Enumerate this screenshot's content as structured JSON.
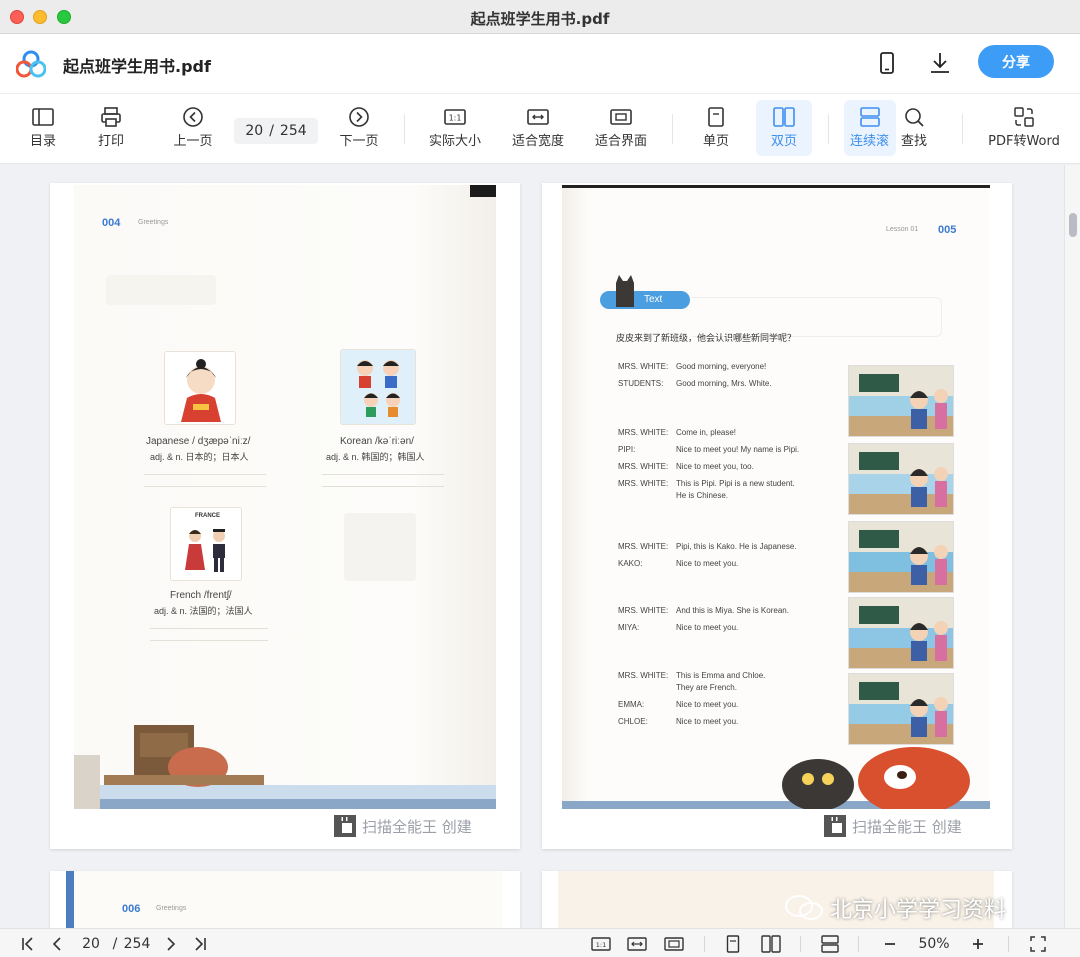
{
  "window": {
    "title": "起点班学生用书.pdf"
  },
  "header": {
    "file_name": "起点班学生用书.pdf",
    "share_label": "分享"
  },
  "toolbar": {
    "toc": "目录",
    "print": "打印",
    "prev": "上一页",
    "current_page": "20",
    "separator": "/",
    "total_pages": "254",
    "next": "下一页",
    "actual_size": "实际大小",
    "fit_width": "适合宽度",
    "fit_window": "适合界面",
    "single": "单页",
    "double": "双页",
    "continuous": "连续滚",
    "find": "查找",
    "pdf_to_word": "PDF转Word"
  },
  "pages": {
    "left": {
      "page_no": "004",
      "section": "Greetings",
      "words": [
        {
          "word": "Japanese / dʒæpəˈniːz/",
          "def": "adj. & n. 日本的；日本人"
        },
        {
          "word": "Korean /kəˈriːən/",
          "def": "adj. & n. 韩国的；韩国人"
        },
        {
          "word": "French /frentʃ/",
          "def": "adj. & n. 法国的；法国人"
        }
      ],
      "flag_label": "FRANCE"
    },
    "right": {
      "lesson": "Lesson 01",
      "page_no": "005",
      "badge": "Text",
      "intro": "皮皮来到了新班级，他会认识哪些新同学呢？",
      "dialogue": [
        {
          "s": "MRS. WHITE:",
          "t": "Good morning, everyone!"
        },
        {
          "s": "STUDENTS:",
          "t": "Good morning, Mrs. White."
        },
        {
          "s": "MRS. WHITE:",
          "t": "Come in, please!"
        },
        {
          "s": "PIPI:",
          "t": "Nice to meet you! My name is Pipi."
        },
        {
          "s": "MRS. WHITE:",
          "t": "Nice to meet you, too."
        },
        {
          "s": "MRS. WHITE:",
          "t": "This is Pipi. Pipi is a new student."
        },
        {
          "s": "",
          "t": "He is Chinese."
        },
        {
          "s": "MRS. WHITE:",
          "t": "Pipi, this is Kako. He is Japanese."
        },
        {
          "s": "KAKO:",
          "t": "Nice to meet you."
        },
        {
          "s": "MRS. WHITE:",
          "t": "And this is Miya. She is Korean."
        },
        {
          "s": "MIYA:",
          "t": "Nice to meet you."
        },
        {
          "s": "MRS. WHITE:",
          "t": "This is Emma and Chloe."
        },
        {
          "s": "",
          "t": "They are French."
        },
        {
          "s": "EMMA:",
          "t": "Nice to meet you."
        },
        {
          "s": "CHLOE:",
          "t": "Nice to meet you."
        }
      ]
    },
    "bottom_left": {
      "page_no": "006",
      "section": "Greetings"
    }
  },
  "watermark": "扫描全能王 创建",
  "overlay_brand": "北京小学学习资料",
  "bottombar": {
    "current_page": "20",
    "separator": "/",
    "total_pages": "254",
    "zoom": "50%"
  },
  "colors": {
    "accent": "#3d9cf6",
    "active_bg": "#eaf3fe"
  },
  "icons": [
    "app-logo-icon",
    "phone-icon",
    "download-icon",
    "toc-icon",
    "print-icon",
    "prev-page-icon",
    "next-page-icon",
    "actual-size-icon",
    "fit-width-icon",
    "fit-window-icon",
    "single-page-icon",
    "double-page-icon",
    "continuous-icon",
    "search-icon",
    "pdf-to-word-icon"
  ]
}
